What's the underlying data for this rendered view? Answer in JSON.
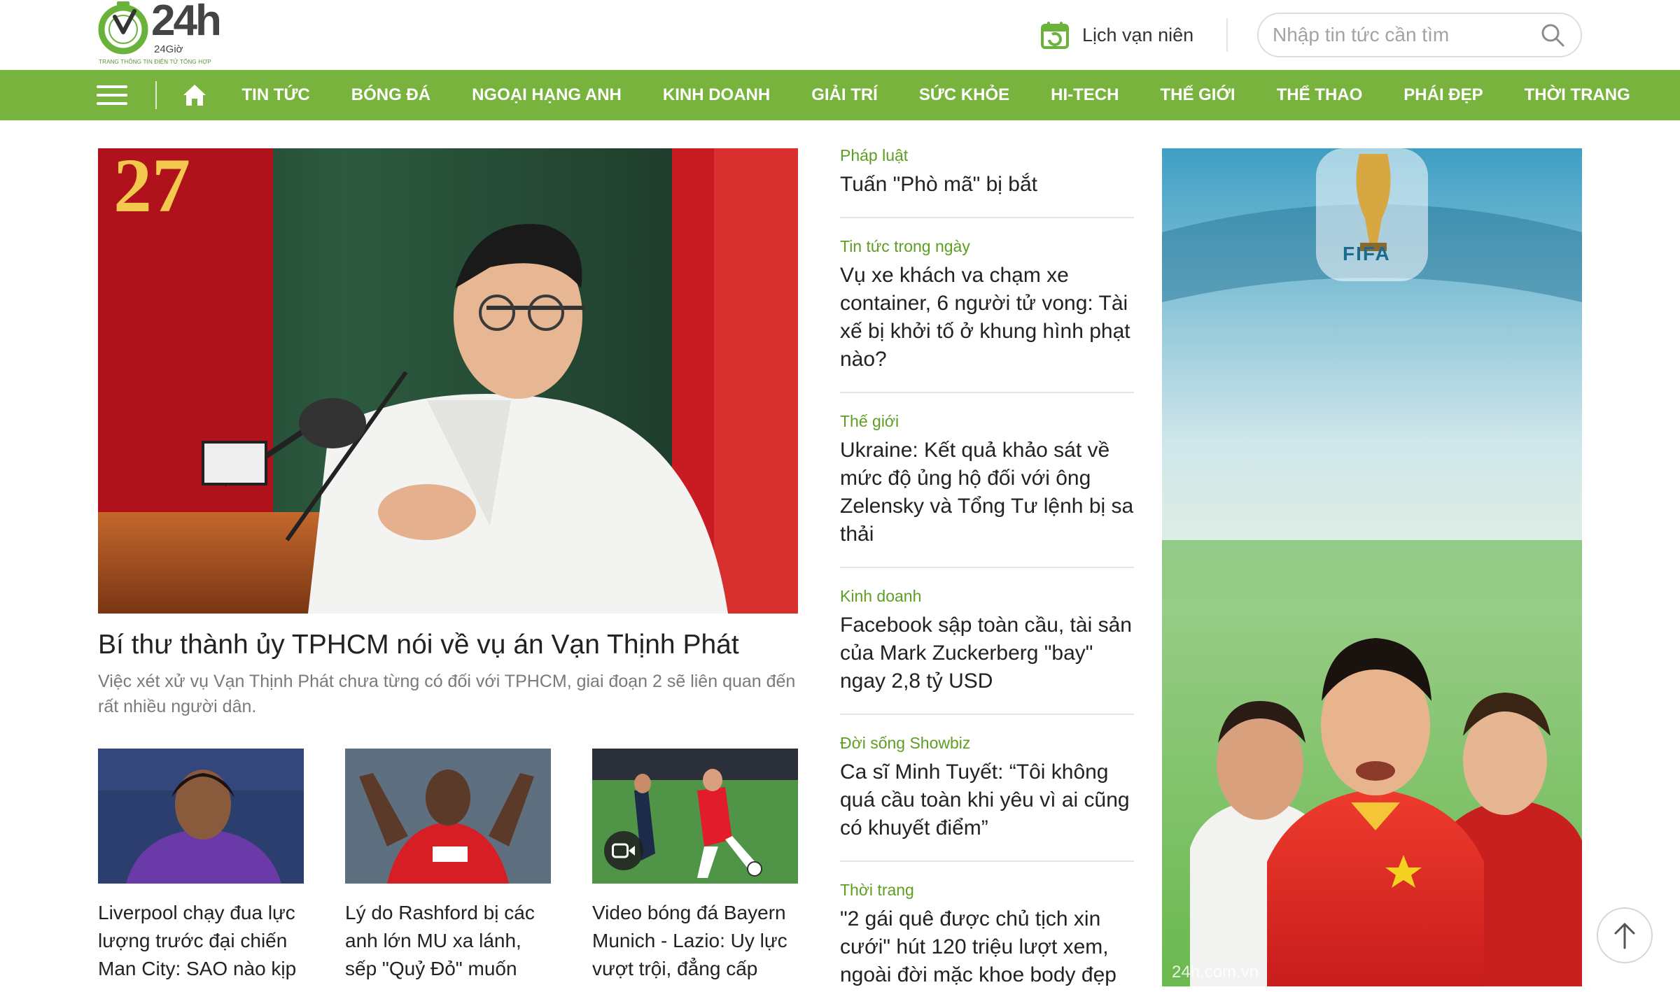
{
  "header": {
    "logo_text": "24h",
    "logo_sub": "24Giờ",
    "logo_tagline": "TRANG THÔNG TIN ĐIỆN TỬ TỔNG HỢP",
    "calendar_label": "Lịch vạn niên",
    "search_placeholder": "Nhập tin tức cần tìm"
  },
  "nav": {
    "items": [
      "TIN TỨC",
      "BÓNG ĐÁ",
      "NGOẠI HẠNG ANH",
      "KINH DOANH",
      "GIẢI TRÍ",
      "SỨC KHỎE",
      "HI-TECH",
      "THẾ GIỚI",
      "THỂ THAO",
      "PHÁI ĐẸP",
      "THỜI TRANG"
    ]
  },
  "feature": {
    "title": "Bí thư thành ủy TPHCM nói về vụ án Vạn Thịnh Phát",
    "sapo": "Việc xét xử vụ Vạn Thịnh Phát chưa từng có đối với TPHCM, giai đoạn 2 sẽ liên quan đến rất nhiều người dân."
  },
  "cards": [
    {
      "title": "Liverpool chạy đua lực lượng trước đại chiến Man City: SAO nào kịp"
    },
    {
      "title": "Lý do Rashford bị các anh lớn MU xa lánh, sếp \"Quỷ Đỏ\" muốn"
    },
    {
      "title": "Video bóng đá Bayern Munich - Lazio: Uy lực vượt trội, đẳng cấp"
    }
  ],
  "side": [
    {
      "category": "Pháp luật",
      "title": "Tuấn \"Phò mã\" bị bắt"
    },
    {
      "category": "Tin tức trong ngày",
      "title": "Vụ xe khách va chạm xe container, 6 người tử vong: Tài xế bị khởi tố ở khung hình phạt nào?"
    },
    {
      "category": "Thế giới",
      "title": "Ukraine: Kết quả khảo sát về mức độ ủng hộ đối với ông Zelensky và Tổng Tư lệnh bị sa thải"
    },
    {
      "category": "Kinh doanh",
      "title": "Facebook sập toàn cầu, tài sản của Mark Zuckerberg \"bay\" ngay 2,8 tỷ USD"
    },
    {
      "category": "Đời sống Showbiz",
      "title": "Ca sĩ Minh Tuyết: “Tôi không quá cầu toàn khi yêu vì ai cũng có khuyết điểm”"
    },
    {
      "category": "Thời trang",
      "title": "\"2 gái quê được chủ tịch xin cưới\" hút 120 triệu lượt xem, ngoài đời mặc khoe body đẹp"
    }
  ],
  "ad": {
    "badge": "FIFA",
    "watermark": "24h.com.vn"
  },
  "colors": {
    "brand_green": "#78b43d",
    "category_green": "#5e9e23"
  },
  "icons": [
    "calendar-icon",
    "search-icon",
    "hamburger-icon",
    "home-icon",
    "video-icon",
    "arrow-up-icon"
  ]
}
